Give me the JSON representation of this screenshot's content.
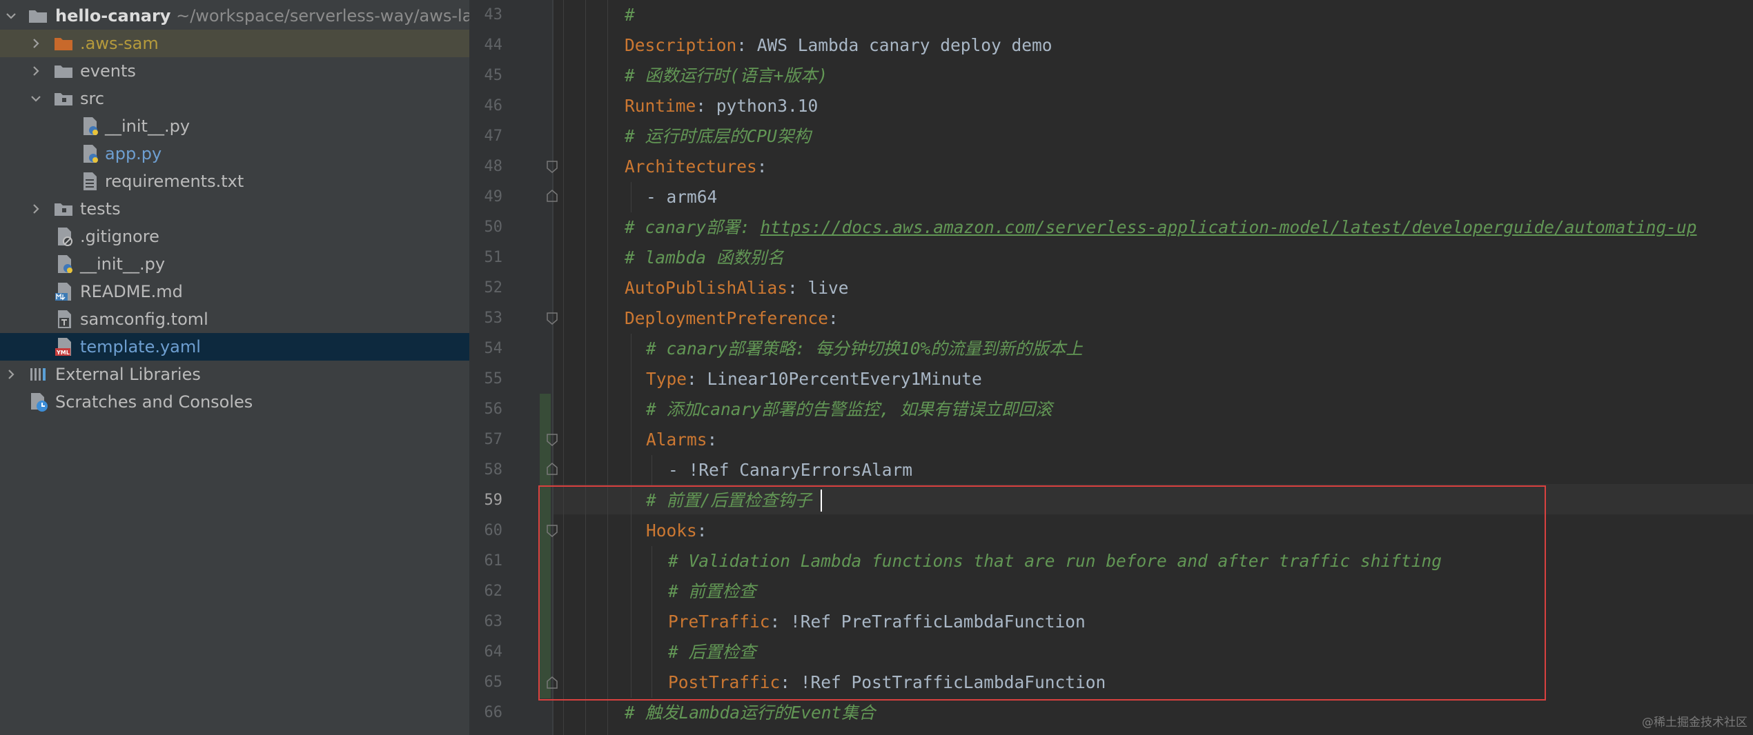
{
  "project": {
    "root": {
      "name": "hello-canary",
      "path": "~/workspace/serverless-way/aws-la"
    },
    "items": [
      {
        "label": ".aws-sam"
      },
      {
        "label": "events"
      },
      {
        "label": "src"
      },
      {
        "label": "__init__.py"
      },
      {
        "label": "app.py"
      },
      {
        "label": "requirements.txt"
      },
      {
        "label": "tests"
      },
      {
        "label": ".gitignore"
      },
      {
        "label": "__init__.py"
      },
      {
        "label": "README.md"
      },
      {
        "label": "samconfig.toml"
      },
      {
        "label": "template.yaml"
      },
      {
        "label": "External Libraries"
      },
      {
        "label": "Scratches and Consoles"
      }
    ],
    "icon_names": [
      "folder-icon",
      "python-file-icon",
      "text-file-icon",
      "ignore-file-icon",
      "markdown-file-icon",
      "toml-file-icon",
      "yaml-file-icon",
      "libraries-icon",
      "scratches-icon"
    ]
  },
  "editor": {
    "current_line": "59",
    "line_numbers": [
      "43",
      "44",
      "45",
      "46",
      "47",
      "48",
      "49",
      "50",
      "51",
      "52",
      "53",
      "54",
      "55",
      "56",
      "57",
      "58",
      "59",
      "60",
      "61",
      "62",
      "63",
      "64",
      "65",
      "66"
    ],
    "lines": [
      {
        "t": "#"
      },
      {
        "k": "Description",
        "t": ": AWS Lambda canary deploy demo"
      },
      {
        "t": "# 函数运行时(语言+版本)"
      },
      {
        "k": "Runtime",
        "t": ": python3.10"
      },
      {
        "t": "# 运行时底层的CPU架构"
      },
      {
        "k": "Architectures",
        "t": ":"
      },
      {
        "t": "- arm64"
      },
      {
        "c": "# canary部署: ",
        "u": "https://docs.aws.amazon.com/serverless-application-model/latest/developerguide/automating-up"
      },
      {
        "t": "# lambda 函数别名"
      },
      {
        "k": "AutoPublishAlias",
        "t": ": live"
      },
      {
        "k": "DeploymentPreference",
        "t": ":"
      },
      {
        "t": "# canary部署策略: 每分钟切换10%的流量到新的版本上"
      },
      {
        "k": "Type",
        "t": ": Linear10PercentEvery1Minute"
      },
      {
        "t": "# 添加canary部署的告警监控, 如果有错误立即回滚"
      },
      {
        "k": "Alarms",
        "t": ":"
      },
      {
        "t": "- !Ref CanaryErrorsAlarm"
      },
      {
        "t": "# 前置/后置检查钩子"
      },
      {
        "k": "Hooks",
        "t": ":"
      },
      {
        "t": "# Validation Lambda functions that are run before and after traffic shifting"
      },
      {
        "t": "# 前置检查"
      },
      {
        "k": "PreTraffic",
        "t": ": !Ref PreTrafficLambdaFunction"
      },
      {
        "t": "# 后置检查"
      },
      {
        "k": "PostTraffic",
        "t": ": !Ref PostTrafficLambdaFunction"
      },
      {
        "t": "# 触发Lambda运行的Event集合"
      }
    ]
  },
  "colors": {
    "tree_bg": "#3c3f41",
    "editor_bg": "#2b2b2b",
    "keyword": "#cc7832",
    "comment": "#629755",
    "selection": "#0d293e",
    "highlight_border": "#d9413f"
  },
  "watermark": "@稀土掘金技术社区"
}
